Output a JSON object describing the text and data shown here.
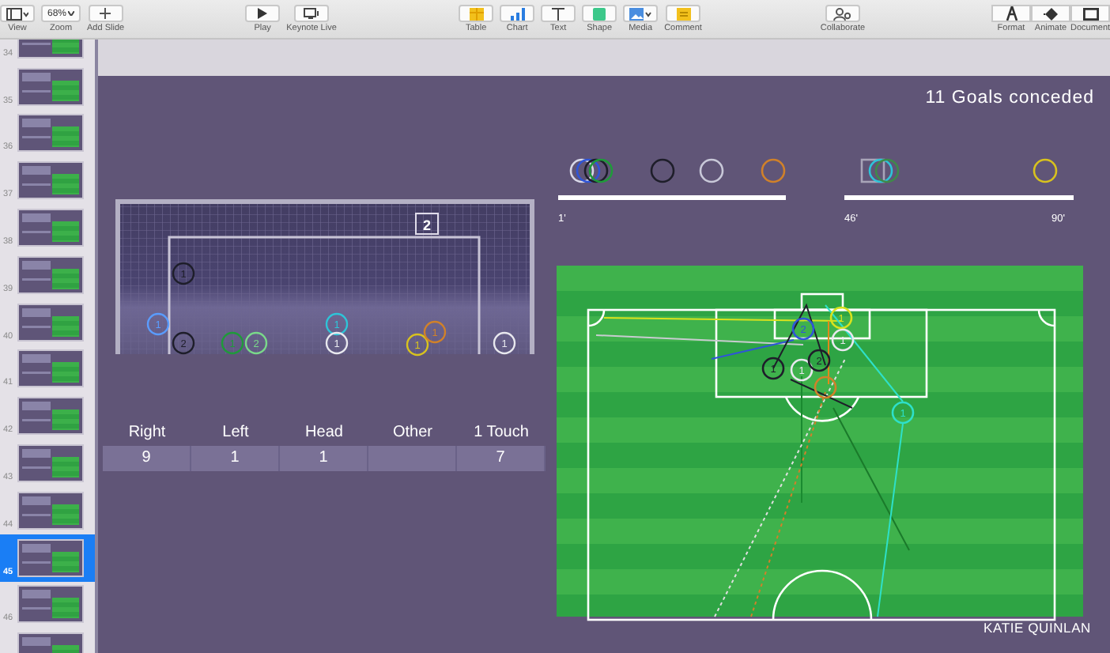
{
  "toolbar": {
    "groups": [
      {
        "items": [
          {
            "kind": "view",
            "label": "View"
          },
          {
            "kind": "zoom",
            "label": "Zoom",
            "value": "68%"
          },
          {
            "kind": "add",
            "label": "Add Slide"
          }
        ]
      },
      {
        "items": [
          {
            "kind": "play",
            "label": "Play"
          },
          {
            "kind": "live",
            "label": "Keynote Live"
          }
        ]
      },
      {
        "items": [
          {
            "kind": "table",
            "label": "Table"
          },
          {
            "kind": "chart",
            "label": "Chart"
          },
          {
            "kind": "text",
            "label": "Text"
          },
          {
            "kind": "shape",
            "label": "Shape"
          },
          {
            "kind": "media",
            "label": "Media"
          },
          {
            "kind": "comment",
            "label": "Comment"
          }
        ]
      },
      {
        "items": [
          {
            "kind": "collaborate",
            "label": "Collaborate"
          }
        ]
      },
      {
        "items": [
          {
            "kind": "format",
            "label": "Format"
          },
          {
            "kind": "animate",
            "label": "Animate"
          },
          {
            "kind": "document",
            "label": "Document"
          }
        ]
      }
    ]
  },
  "navigator": {
    "slides": [
      {
        "number": "34",
        "selected": false
      },
      {
        "number": "35",
        "selected": false
      },
      {
        "number": "36",
        "selected": false
      },
      {
        "number": "37",
        "selected": false
      },
      {
        "number": "38",
        "selected": false
      },
      {
        "number": "39",
        "selected": false
      },
      {
        "number": "40",
        "selected": false
      },
      {
        "number": "41",
        "selected": false
      },
      {
        "number": "42",
        "selected": false
      },
      {
        "number": "43",
        "selected": false
      },
      {
        "number": "44",
        "selected": false
      },
      {
        "number": "45",
        "selected": true
      },
      {
        "number": "46",
        "selected": false
      },
      {
        "selected": false
      }
    ]
  },
  "slide": {
    "title": "11 Goals conceded",
    "goal": {
      "box_label": "2",
      "markers": [
        {
          "label": "1",
          "color": "#1e1e2a"
        },
        {
          "label": "1",
          "color": "#5a9cff"
        },
        {
          "label": "2",
          "color": "#1e1e2a"
        },
        {
          "label": "1",
          "color": "#1f9a3a"
        },
        {
          "label": "2",
          "color": "#7ad88a"
        },
        {
          "label": "1",
          "color": "#2ec4d8"
        },
        {
          "label": "1",
          "color": "#e8e8ee"
        },
        {
          "label": "1",
          "color": "#d8c21e"
        },
        {
          "label": "1",
          "color": "#d0812a"
        },
        {
          "label": "1",
          "color": "#e8e8ee"
        }
      ]
    },
    "table": {
      "columns": [
        {
          "label": "Right",
          "value": "9"
        },
        {
          "label": "Left",
          "value": "1"
        },
        {
          "label": "Head",
          "value": "1"
        },
        {
          "label": "Other"
        },
        {
          "label": "1 Touch",
          "value": "7"
        }
      ]
    },
    "timeline": {
      "labels": [
        "1'",
        "46'",
        "90'"
      ],
      "markers": [
        {
          "kind": "circle",
          "color": "#d8d8e8"
        },
        {
          "kind": "circle",
          "color": "#2f55d8"
        },
        {
          "kind": "circle",
          "color": "#1e1e2a"
        },
        {
          "kind": "circle",
          "color": "#1f9a3a"
        },
        {
          "kind": "circle",
          "color": "#1e1e2a"
        },
        {
          "kind": "circle",
          "color": "#c8c8d8"
        },
        {
          "kind": "circle",
          "color": "#d0812a"
        },
        {
          "kind": "square",
          "color": "#a8a4b8"
        },
        {
          "kind": "circle",
          "color": "#2ec4d8"
        },
        {
          "kind": "circle",
          "color": "#3f8a4a"
        },
        {
          "kind": "circle",
          "color": "#d8c21e"
        }
      ]
    },
    "pitch": {
      "markers": [
        {
          "label": "1",
          "color": "#d8e21e"
        },
        {
          "label": "2",
          "color": "#2f55d8"
        },
        {
          "label": "1",
          "color": "#e8e8ee"
        },
        {
          "label": "1",
          "color": "#1e1e2a"
        },
        {
          "label": "1",
          "color": "#e8e8ee"
        },
        {
          "label": "2",
          "color": "#1e1e2a"
        },
        {
          "color": "#d0812a"
        },
        {
          "label": "1",
          "color": "#2ee0c8"
        }
      ]
    },
    "author": "KATIE QUINLAN"
  }
}
